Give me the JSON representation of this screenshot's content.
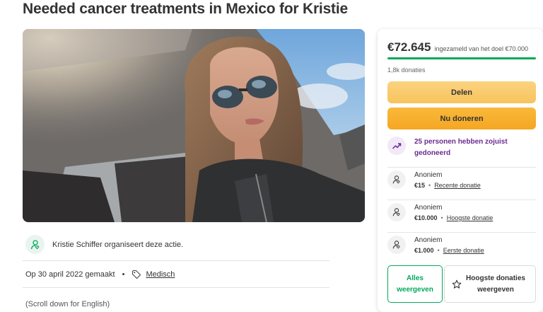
{
  "campaign": {
    "title": "Needed cancer treatments in Mexico for Kristie",
    "organizer_text": "Kristie Schiffer organiseert deze actie.",
    "created": "Op 30 april 2022 gemaakt",
    "category": "Medisch",
    "scroll_note": "(Scroll down for English)"
  },
  "donation_panel": {
    "raised": "€72.645",
    "goal_text": "ingezameld van het doel €70.000",
    "progress_fraction": 1.0,
    "donations_count": "1,8k donaties",
    "share_label": "Delen",
    "donate_label": "Nu doneren",
    "trend_text": "25 personen hebben zojuist gedoneerd",
    "donations": [
      {
        "name": "Anoniem",
        "amount": "€15",
        "label": "Recente donatie"
      },
      {
        "name": "Anoniem",
        "amount": "€10.000",
        "label": "Hoogste donatie"
      },
      {
        "name": "Anoniem",
        "amount": "€1.000",
        "label": "Eerste donatie"
      }
    ],
    "see_all_label": "Alles weergeven",
    "top_donations_label": "Hoogste donaties weergeven"
  },
  "colors": {
    "accent_green": "#02a95c",
    "share_button": "#f7c35d",
    "donate_button": "#f5a623",
    "trend_purple": "#6b2b8f"
  },
  "icons": [
    "user-heart-icon",
    "tag-icon",
    "trending-up-icon",
    "star-icon"
  ]
}
